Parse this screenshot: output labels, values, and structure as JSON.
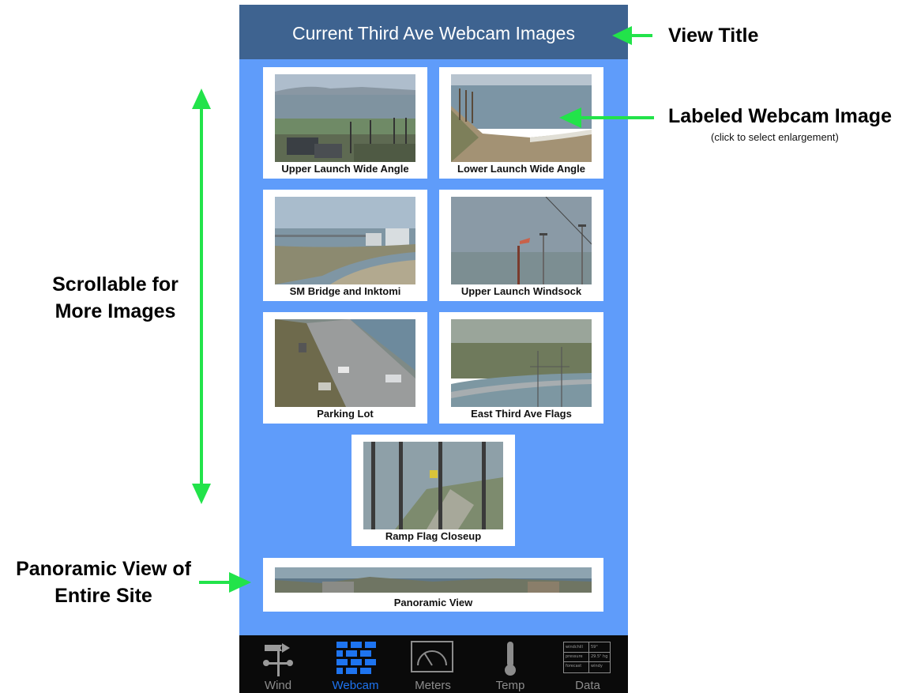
{
  "screen": {
    "title": "Current Third Ave Webcam Images",
    "header_color": "#3e6390",
    "background_color": "#5f9cfa",
    "webcams": [
      {
        "label": "Upper Launch Wide Angle"
      },
      {
        "label": "Lower Launch Wide Angle"
      },
      {
        "label": "SM Bridge and Inktomi"
      },
      {
        "label": "Upper Launch Windsock"
      },
      {
        "label": "Parking Lot"
      },
      {
        "label": "East Third Ave Flags"
      },
      {
        "label": "Ramp Flag Closeup"
      }
    ],
    "panorama": {
      "label": "Panoramic View"
    }
  },
  "tabbar": {
    "active_color": "#1e74f0",
    "tabs": [
      {
        "label": "Wind",
        "icon": "wind-vane-icon"
      },
      {
        "label": "Webcam",
        "icon": "webcam-grid-icon"
      },
      {
        "label": "Meters",
        "icon": "meter-gauge-icon"
      },
      {
        "label": "Temp",
        "icon": "thermometer-icon"
      },
      {
        "label": "Data",
        "icon": "data-table-icon"
      }
    ],
    "active_index": 1,
    "data_icon_cells": [
      "windchill",
      "59°",
      "pressure",
      "29.5\" hg",
      "forecast",
      "windy"
    ]
  },
  "annotations": {
    "view_title": "View Title",
    "labeled_image": "Labeled Webcam Image",
    "labeled_image_note": "(click to select enlargement)",
    "scrollable_line1": "Scrollable for",
    "scrollable_line2": "More Images",
    "panoramic_line1": "Panoramic View of",
    "panoramic_line2": "Entire Site",
    "arrow_color": "#22e34a"
  }
}
